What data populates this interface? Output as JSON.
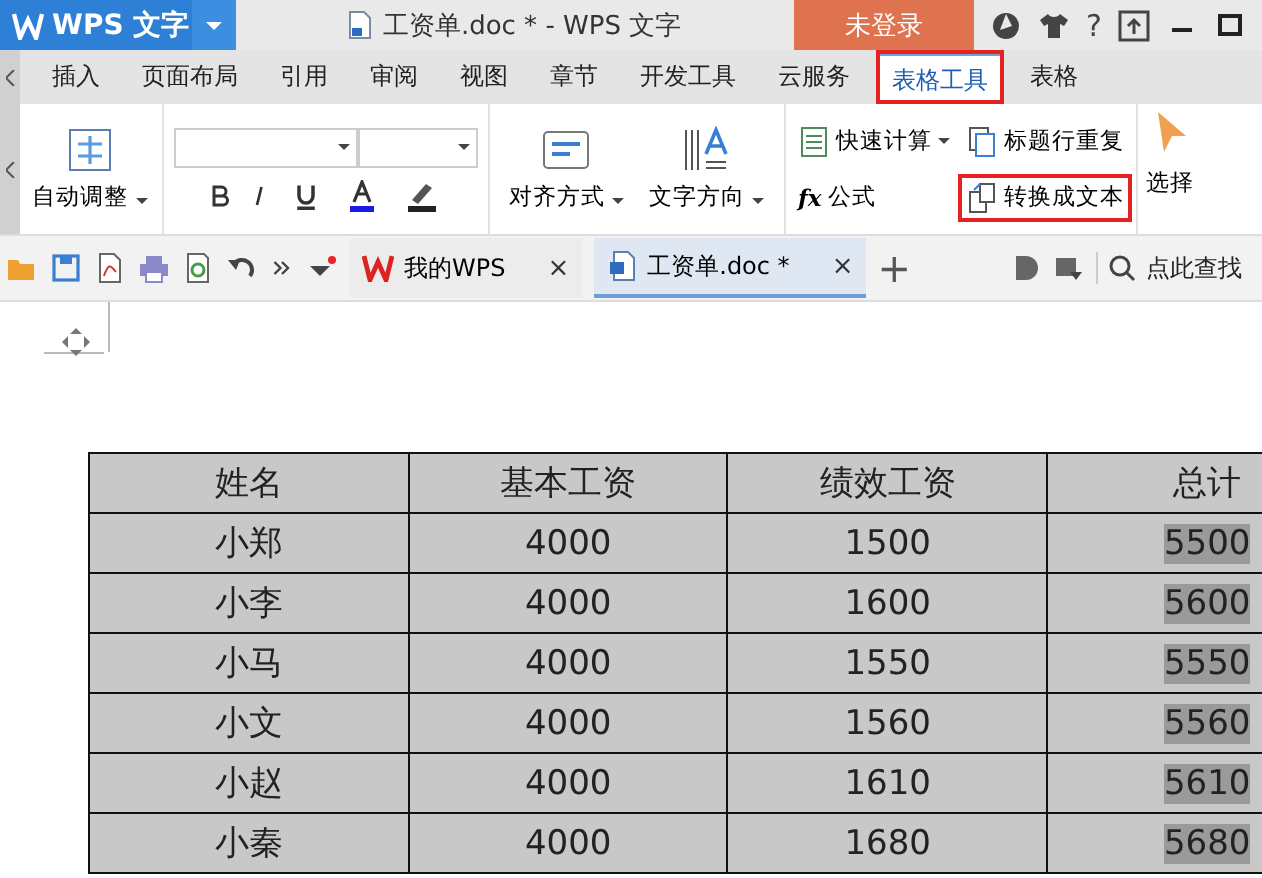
{
  "app": {
    "logo": "WPS 文字",
    "title": "工资单.doc * - WPS 文字",
    "login": "未登录",
    "help": "?"
  },
  "ribbon_tabs": [
    {
      "label": "插入",
      "selected": false,
      "highlighted": false
    },
    {
      "label": "页面布局",
      "selected": false,
      "highlighted": false
    },
    {
      "label": "引用",
      "selected": false,
      "highlighted": false
    },
    {
      "label": "审阅",
      "selected": false,
      "highlighted": false
    },
    {
      "label": "视图",
      "selected": false,
      "highlighted": false
    },
    {
      "label": "章节",
      "selected": false,
      "highlighted": false
    },
    {
      "label": "开发工具",
      "selected": false,
      "highlighted": false
    },
    {
      "label": "云服务",
      "selected": false,
      "highlighted": false
    },
    {
      "label": "表格工具",
      "selected": true,
      "highlighted": true
    },
    {
      "label": "表格",
      "selected": false,
      "highlighted": false
    }
  ],
  "ribbon": {
    "auto_fit": "自动调整",
    "align": "对齐方式",
    "text_direction": "文字方向",
    "quick_calc": "快速计算",
    "repeat_header": "标题行重复",
    "formula": {
      "symbol": "fx",
      "label": "公式"
    },
    "convert": {
      "label": "转换成文本",
      "highlighted": true
    },
    "select": "选择"
  },
  "doc_tabs": [
    {
      "label": "我的WPS",
      "selected": false,
      "close": "×"
    },
    {
      "label": "工资单.doc *",
      "selected": true,
      "close": "×"
    }
  ],
  "new_tab": "+",
  "search": {
    "placeholder": "点此查找"
  },
  "table": {
    "columns": [
      "姓名",
      "基本工资",
      "绩效工资",
      "总计"
    ],
    "rows": [
      {
        "cells": [
          "小郑",
          "4000",
          "1500",
          "5500"
        ],
        "total_selected": true
      },
      {
        "cells": [
          "小李",
          "4000",
          "1600",
          "5600"
        ],
        "total_selected": true
      },
      {
        "cells": [
          "小马",
          "4000",
          "1550",
          "5550"
        ],
        "total_selected": true
      },
      {
        "cells": [
          "小文",
          "4000",
          "1560",
          "5560"
        ],
        "total_selected": true
      },
      {
        "cells": [
          "小赵",
          "4000",
          "1610",
          "5610"
        ],
        "total_selected": true
      },
      {
        "cells": [
          "小秦",
          "4000",
          "1680",
          "5680"
        ],
        "total_selected": true
      }
    ]
  }
}
